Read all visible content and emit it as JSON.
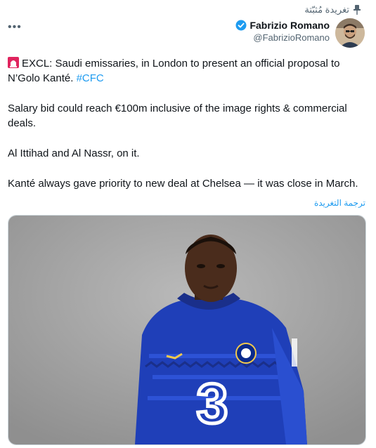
{
  "pinned": {
    "label": "تغريدة مُثبّتة",
    "icon": "pin-icon"
  },
  "author": {
    "name": "Fabrizio Romano",
    "handle": "@FabrizioRomano",
    "verified": true,
    "avatar": "avatar"
  },
  "menu": {
    "icon": "more-icon",
    "glyph": "•••"
  },
  "tweet": {
    "p1_text": "EXCL: Saudi emissaries, in London to present an official proposal to N’Golo Kanté.",
    "p1_hashtag": "#CFC",
    "p2": "Salary bid could reach €100m inclusive of the image rights & commercial deals.",
    "p3": "Al Ittihad and Al Nassr, on it.",
    "p4": "Kanté always gave priority to new deal at Chelsea — it was close in March."
  },
  "translate_label": "ترجمة التغريدة",
  "colors": {
    "accent": "#1d9bf0",
    "secondary_text": "#536471",
    "kit_blue": "#1f3fb8"
  }
}
